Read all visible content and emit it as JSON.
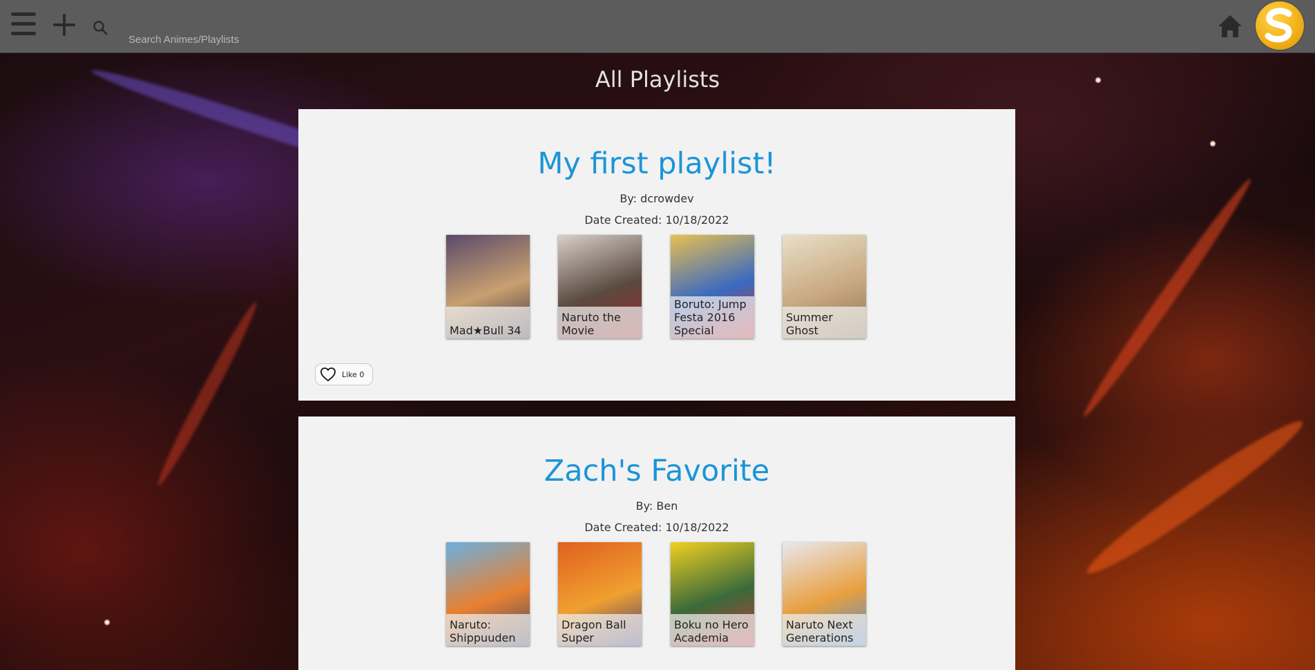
{
  "header": {
    "search": {
      "placeholder": "Search Animes/Playlists",
      "value": ""
    },
    "avatar_letter": "S"
  },
  "page": {
    "title": "All Playlists"
  },
  "playlists": [
    {
      "title": "My first playlist!",
      "author": "By: dcrowdev",
      "date": "Date Created: 10/18/2022",
      "likes": "Like 0",
      "animes": [
        {
          "name": "Mad★Bull 34",
          "colors": [
            "#5a4a6a",
            "#c8a070",
            "#3a3040"
          ]
        },
        {
          "name": "Naruto the Movie",
          "colors": [
            "#d8d0c8",
            "#5a4a40",
            "#9c2a2a"
          ]
        },
        {
          "name": "Boruto: Jump Festa 2016 Special",
          "colors": [
            "#e8c050",
            "#3a6ac0",
            "#c83030"
          ]
        },
        {
          "name": "Summer Ghost",
          "colors": [
            "#e8e0c8",
            "#c8a880",
            "#8a7050"
          ]
        }
      ]
    },
    {
      "title": "Zach's Favorite",
      "author": "By: Ben",
      "date": "Date Created: 10/18/2022",
      "animes": [
        {
          "name": "Naruto: Shippuuden",
          "colors": [
            "#6ab0e0",
            "#e88030",
            "#3a4a6a"
          ]
        },
        {
          "name": "Dragon Ball Super",
          "colors": [
            "#e06020",
            "#f0a030",
            "#3a3a80"
          ]
        },
        {
          "name": "Boku no Hero Academia",
          "colors": [
            "#f0d020",
            "#3a6a3a",
            "#c83a3a"
          ]
        },
        {
          "name": "Naruto Next Generations",
          "colors": [
            "#e8e8f0",
            "#e8a040",
            "#4a8ad0"
          ]
        }
      ]
    }
  ]
}
